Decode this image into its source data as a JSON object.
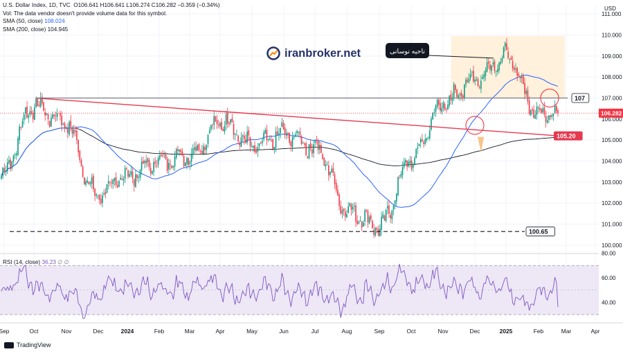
{
  "legend": {
    "symbol": "U.S. Dollar Index, 1D, TVC",
    "o_label": "O",
    "o": "106.641",
    "h_label": "H",
    "h": "106.641",
    "l_label": "L",
    "l": "106.274",
    "c_label": "C",
    "c": "106.282",
    "change": "−0.359 (−0.34%)",
    "vol_note": "Vol: The data vendor doesn't provide volume data for this symbol.",
    "sma50_label": "SMA (50, close)",
    "sma50_value": "108.024",
    "sma200_label": "SMA (200, close)",
    "sma200_value": "104.945"
  },
  "rsi_legend": {
    "label": "RSI (14, close)",
    "value": "36.23",
    "extra": "∅ ∅"
  },
  "watermark": {
    "text": "iranbroker.net"
  },
  "footer": {
    "brand": "TradingView"
  },
  "colors": {
    "up": "#089981",
    "down": "#f23645",
    "sma50": "#2962ff",
    "sma200": "#131722",
    "rsi": "#7e57c2",
    "rsi_band": "#ede7f6",
    "zone": "#fff1dc",
    "trendline": "#e53950"
  },
  "chart_data": {
    "type": "candlestick",
    "currency": "USD",
    "x_ticks": [
      "Sep",
      "Oct",
      "Nov",
      "Dec",
      "2024",
      "Feb",
      "Mar",
      "Apr",
      "May",
      "Jun",
      "Jul",
      "Aug",
      "Sep",
      "Oct",
      "Nov",
      "Dec",
      "2025",
      "Feb",
      "Mar",
      "Apr"
    ],
    "y_ticks": [
      "111.000",
      "110.000",
      "109.000",
      "108.000",
      "107.000",
      "106.000",
      "105.000",
      "104.000",
      "103.000",
      "102.000",
      "101.000",
      "100.000"
    ],
    "ylim": [
      99.8,
      111.4
    ],
    "last_price": "106.282",
    "levels": [
      {
        "label": "107",
        "value": 107.0
      },
      {
        "label": "105.20",
        "value": 105.2
      },
      {
        "label": "100.65",
        "value": 100.65
      }
    ],
    "annotation": "ناحیه نوسانی",
    "close_path": [
      {
        "month": "Sep 2023",
        "close": 103.3
      },
      {
        "month": "Oct 2023",
        "close": 106.6
      },
      {
        "month": "Nov 2023",
        "close": 105.9
      },
      {
        "month": "Dec 2023",
        "close": 102.4
      },
      {
        "month": "Jan 2024",
        "close": 103.3
      },
      {
        "month": "Feb 2024",
        "close": 104.0
      },
      {
        "month": "Mar 2024",
        "close": 104.3
      },
      {
        "month": "Apr 2024",
        "close": 105.9
      },
      {
        "month": "May 2024",
        "close": 104.7
      },
      {
        "month": "Jun 2024",
        "close": 105.3
      },
      {
        "month": "Jul 2024",
        "close": 104.6
      },
      {
        "month": "Aug 2024",
        "close": 101.6
      },
      {
        "month": "Sep 2024",
        "close": 100.9
      },
      {
        "month": "Oct 2024",
        "close": 104.1
      },
      {
        "month": "Nov 2024",
        "close": 106.7
      },
      {
        "month": "Dec 2024",
        "close": 107.9
      },
      {
        "month": "Jan 2025",
        "close": 109.0
      },
      {
        "month": "Feb 2025",
        "close": 106.3
      }
    ],
    "rsi": {
      "y_ticks": [
        "80.00",
        "60.00",
        "40.00"
      ],
      "ylim": [
        25,
        82
      ],
      "bands": [
        70,
        30
      ],
      "last": 36.23
    }
  }
}
